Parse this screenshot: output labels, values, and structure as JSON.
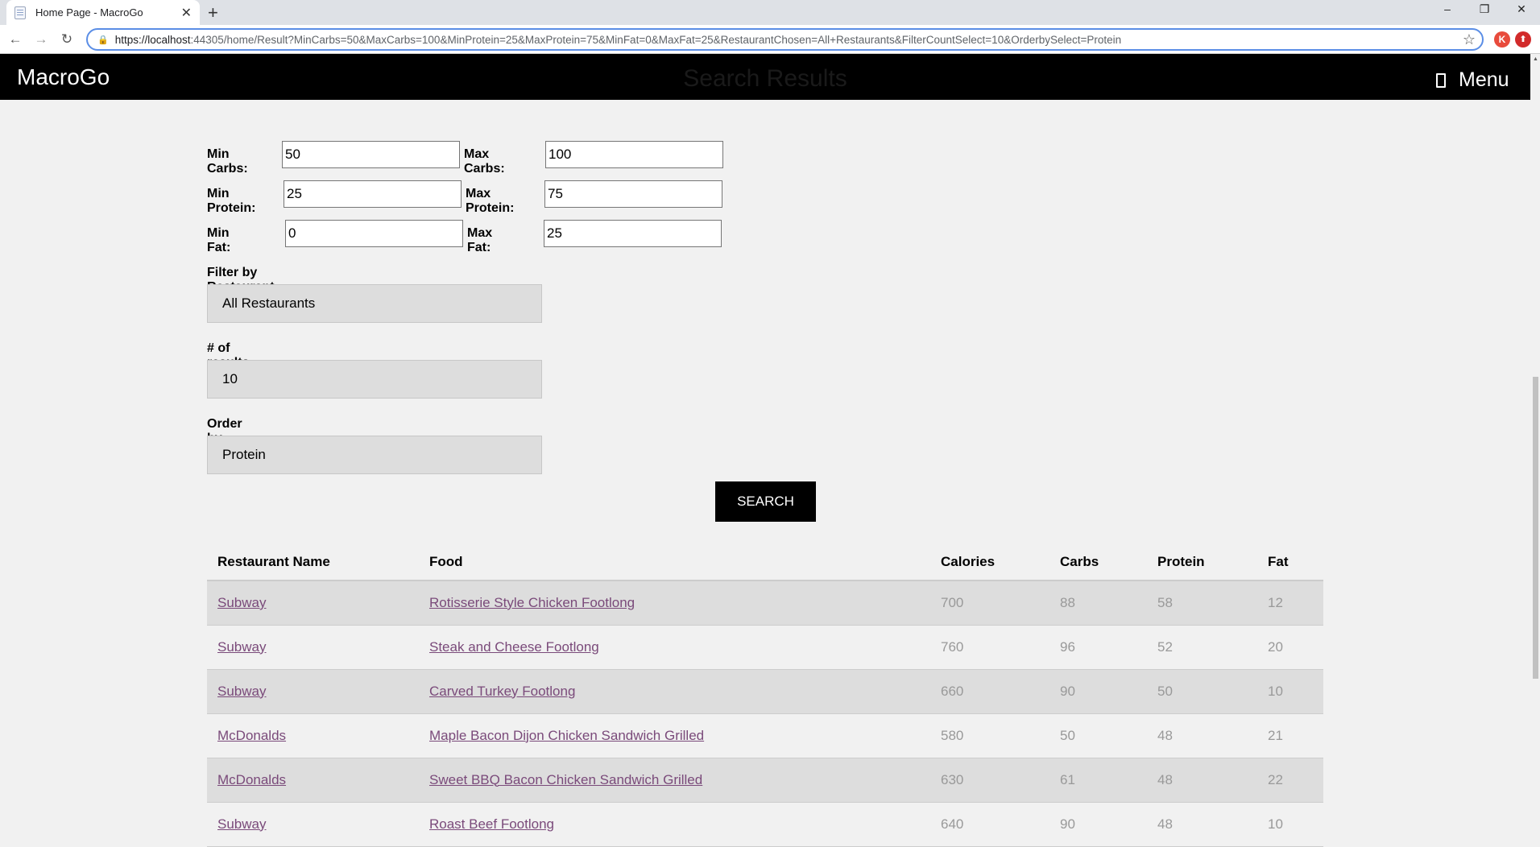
{
  "browser": {
    "tab_title": "Home Page - MacroGo",
    "url_host": "https://localhost",
    "url_rest": ":44305/home/Result?MinCarbs=50&MaxCarbs=100&MinProtein=25&MaxProtein=75&MinFat=0&MaxFat=25&RestaurantChosen=All+Restaurants&FilterCountSelect=10&OrderbySelect=Protein",
    "extension_k": "K"
  },
  "header": {
    "logo": "MacroGo",
    "page_title": "Search Results",
    "menu_label": "Menu"
  },
  "form": {
    "min_carbs_label": "Min Carbs:",
    "min_carbs_value": "50",
    "max_carbs_label": "Max Carbs:",
    "max_carbs_value": "100",
    "min_protein_label": "Min Protein:",
    "min_protein_value": "25",
    "max_protein_label": "Max Protein:",
    "max_protein_value": "75",
    "min_fat_label": "Min Fat:",
    "min_fat_value": "0",
    "max_fat_label": "Max Fat:",
    "max_fat_value": "25",
    "restaurant_label": "Filter by Restaurant",
    "restaurant_value": "All Restaurants",
    "count_label": "# of results:",
    "count_value": "10",
    "order_label": "Order by:",
    "order_value": "Protein",
    "search_button": "SEARCH"
  },
  "table": {
    "headers": [
      "Restaurant Name",
      "Food",
      "Calories",
      "Carbs",
      "Protein",
      "Fat"
    ],
    "rows": [
      {
        "restaurant": "Subway",
        "food": "Rotisserie Style Chicken Footlong",
        "calories": "700",
        "carbs": "88",
        "protein": "58",
        "fat": "12"
      },
      {
        "restaurant": "Subway",
        "food": "Steak and Cheese Footlong",
        "calories": "760",
        "carbs": "96",
        "protein": "52",
        "fat": "20"
      },
      {
        "restaurant": "Subway",
        "food": "Carved Turkey Footlong",
        "calories": "660",
        "carbs": "90",
        "protein": "50",
        "fat": "10"
      },
      {
        "restaurant": "McDonalds",
        "food": "Maple Bacon Dijon Chicken Sandwich Grilled",
        "calories": "580",
        "carbs": "50",
        "protein": "48",
        "fat": "21"
      },
      {
        "restaurant": "McDonalds",
        "food": "Sweet BBQ Bacon Chicken Sandwich Grilled",
        "calories": "630",
        "carbs": "61",
        "protein": "48",
        "fat": "22"
      },
      {
        "restaurant": "Subway",
        "food": "Roast Beef Footlong",
        "calories": "640",
        "carbs": "90",
        "protein": "48",
        "fat": "10"
      }
    ]
  }
}
